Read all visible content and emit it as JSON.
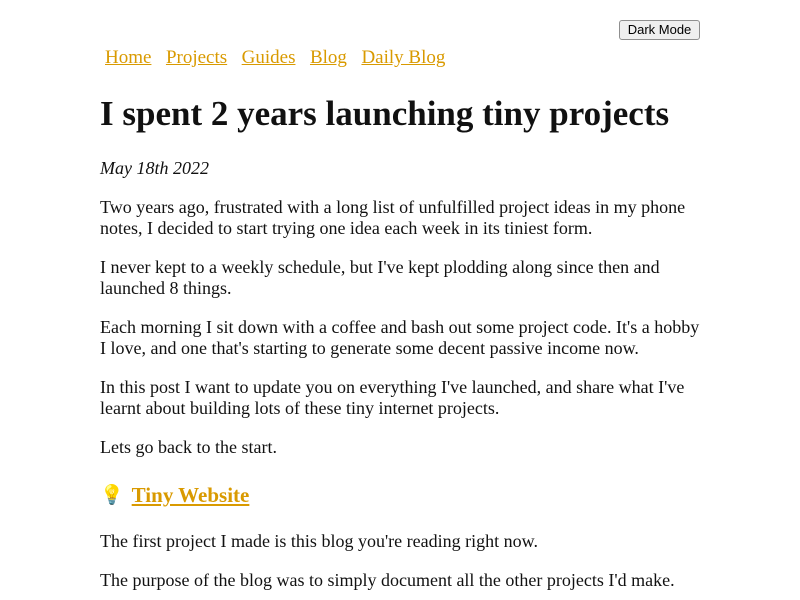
{
  "header": {
    "dark_mode_label": "Dark Mode"
  },
  "nav": {
    "items": [
      {
        "label": "Home"
      },
      {
        "label": "Projects"
      },
      {
        "label": "Guides"
      },
      {
        "label": "Blog"
      },
      {
        "label": "Daily Blog"
      }
    ]
  },
  "article": {
    "title": "I spent 2 years launching tiny projects",
    "date": "May 18th 2022",
    "paragraphs": [
      "Two years ago, frustrated with a long list of unfulfilled project ideas in my phone notes, I decided to start trying one idea each week in its tiniest form.",
      "I never kept to a weekly schedule, but I've kept plodding along since then and launched 8 things.",
      "Each morning I sit down with a coffee and bash out some project code. It's a hobby I love, and one that's starting to generate some decent passive income now.",
      "In this post I want to update you on everything I've launched, and share what I've learnt about building lots of these tiny internet projects.",
      "Lets go back to the start."
    ],
    "section": {
      "icon": "lightbulb-icon",
      "heading": "Tiny Website",
      "paragraphs": [
        "The first project I made is this blog you're reading right now.",
        "The purpose of the blog was to simply document all the other projects I'd make."
      ]
    }
  },
  "colors": {
    "link": "#d99a00",
    "text": "#111111",
    "background": "#ffffff"
  }
}
